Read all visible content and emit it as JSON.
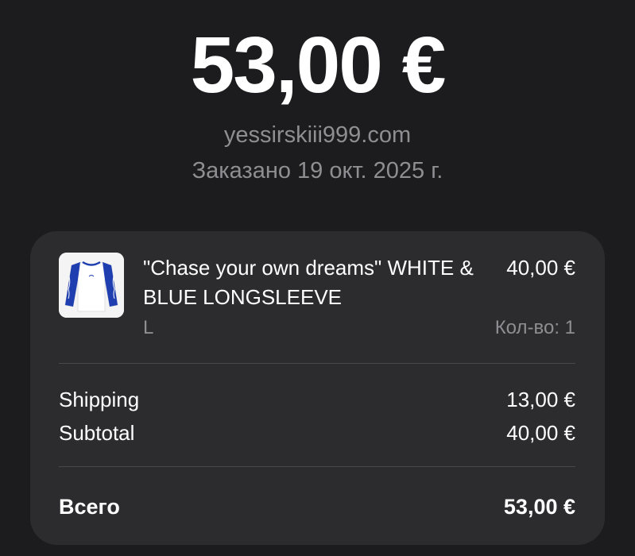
{
  "header": {
    "total_amount": "53,00 €",
    "merchant": "yessirskiii999.com",
    "order_date": "Заказано 19 окт. 2025 г."
  },
  "item": {
    "image_icon": "longsleeve-shirt-thumbnail",
    "title": "\"Chase your own dreams\" WHITE & BLUE LONGSLEEVE",
    "price": "40,00 €",
    "size": "L",
    "quantity": "Кол-во: 1"
  },
  "summary": {
    "shipping_label": "Shipping",
    "shipping_value": "13,00 €",
    "subtotal_label": "Subtotal",
    "subtotal_value": "40,00 €",
    "total_label": "Всего",
    "total_value": "53,00 €"
  },
  "colors": {
    "background": "#1c1c1e",
    "card": "#2c2c2e",
    "secondary_text": "#8e8e93",
    "shirt_blue": "#1f3fb0"
  }
}
